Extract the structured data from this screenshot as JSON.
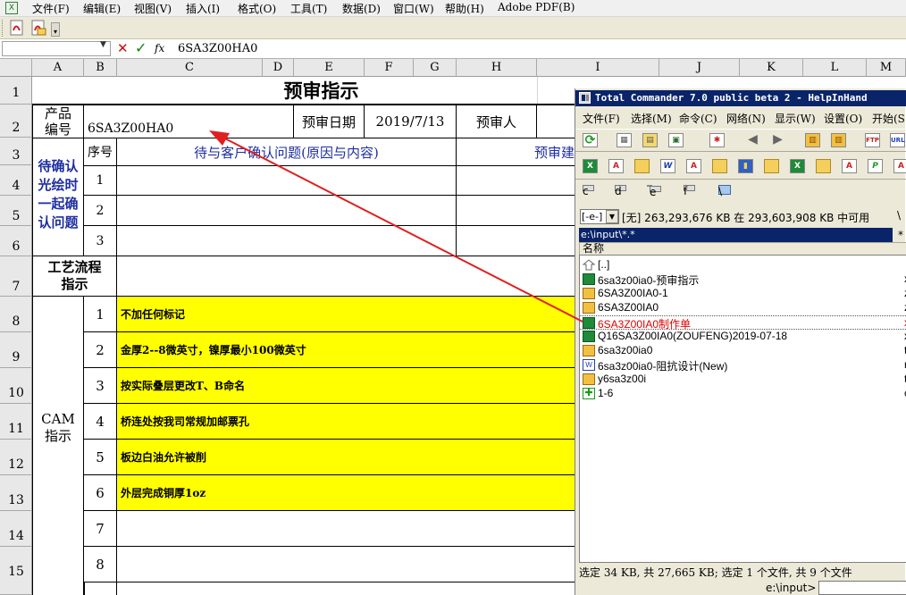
{
  "menubar": {
    "items": [
      "文件(F)",
      "编辑(E)",
      "视图(V)",
      "插入(I)",
      "格式(O)",
      "工具(T)",
      "数据(D)",
      "窗口(W)",
      "帮助(H)",
      "Adobe PDF(B)"
    ]
  },
  "formula": {
    "name_box": "",
    "cancel_icon": "✕",
    "enter_icon": "✓",
    "fx_label": "fx",
    "content": "6SA3Z00HA0"
  },
  "columns": [
    "A",
    "B",
    "C",
    "D",
    "E",
    "F",
    "G",
    "H",
    "I",
    "J",
    "K",
    "L",
    "M"
  ],
  "rows": [
    "1",
    "2",
    "3",
    "4",
    "5",
    "6",
    "7",
    "8",
    "9",
    "10",
    "11",
    "12",
    "13",
    "14",
    "15"
  ],
  "sheet": {
    "title": "预审指示",
    "product_no_label": "产品\n编号",
    "product_no": "6SA3Z00HA0",
    "review_date_label": "预审日期",
    "review_date": "2019/7/13",
    "reviewer_label": "预审人",
    "seq_label": "序号",
    "confirm_header": "待与客户确认问题(原因与内容)",
    "suggest_header": "预审建",
    "confirm_group": "待确认\n光绘时\n一起确\n认问题",
    "confirm_seq": [
      "1",
      "2",
      "3"
    ],
    "process_label": "工艺流程\n指示",
    "cam_label": "CAM\n指示",
    "cam_seq": [
      "1",
      "2",
      "3",
      "4",
      "5",
      "6",
      "7",
      "8"
    ],
    "cam_items": [
      "不加任何标记",
      "金厚2--8微英寸，镍厚最小100微英寸",
      "按实际叠层更改T、B命名",
      "桥连处按我司常规加邮票孔",
      "板边白油允许被削",
      "外层完成铜厚1oz",
      "",
      ""
    ]
  },
  "tc": {
    "title": "Total Commander 7.0 public beta 2 - HelpInHand",
    "menu": [
      "文件(F)",
      "选择(M)",
      "命令(C)",
      "网络(N)",
      "显示(W)",
      "设置(O)",
      "开始(S"
    ],
    "drives": [
      "c",
      "d",
      "e",
      "f",
      "\\"
    ],
    "drive_select": "[-e-]",
    "free_space": "[无]  263,293,676 KB 在 293,603,908 KB 中可用",
    "path_btn": "\\",
    "path": "e:\\input\\*.*",
    "path_star": "*",
    "col_name": "名称",
    "files": [
      {
        "name": "[..]",
        "icon": "up-folder-icon",
        "ext": "",
        "color": "#000000"
      },
      {
        "name": "6sa3z00ia0-预审指示",
        "icon": "excel-file-icon",
        "ext": "x",
        "color": "#000000"
      },
      {
        "name": "6SA3Z00IA0-1",
        "icon": "archive-file-icon",
        "ext": "z",
        "color": "#000000"
      },
      {
        "name": "6SA3Z00IA0",
        "icon": "archive-file-icon",
        "ext": "z",
        "color": "#000000"
      },
      {
        "name": "6SA3Z00IA0制作单",
        "icon": "excel-file-icon",
        "ext": "x",
        "color": "#e00000"
      },
      {
        "name": "Q16SA3Z00IA0(ZOUFENG)2019-07-18",
        "icon": "excel-file-icon",
        "ext": "x",
        "color": "#000000"
      },
      {
        "name": "6sa3z00ia0",
        "icon": "archive-file-icon",
        "ext": "t",
        "color": "#000000"
      },
      {
        "name": "6sa3z00ia0-阻抗设计(New)",
        "icon": "word-file-icon",
        "ext": "r",
        "color": "#000000"
      },
      {
        "name": "y6sa3z00i",
        "icon": "archive-file-icon",
        "ext": "t",
        "color": "#000000"
      },
      {
        "name": "1-6",
        "icon": "green-file-icon",
        "ext": "c",
        "color": "#000000"
      }
    ],
    "status": "选定 34 KB, 共 27,665 KB; 选定 1 个文件, 共 9 个文件",
    "cmd_path": "e:\\input>"
  },
  "colors": {
    "yellow": "#ffff00",
    "tc_title": "#0a246a",
    "arrow": "#e02020",
    "blue_text": "#1f2fa0"
  }
}
